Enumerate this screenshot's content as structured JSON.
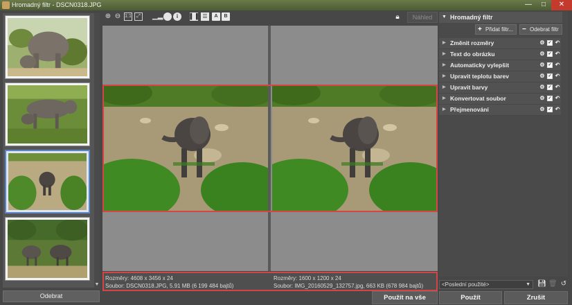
{
  "window": {
    "title": "Hromadný filtr - DSCN0318.JPG",
    "minimize_glyph": "—",
    "maximize_glyph": "□",
    "close_glyph": "✕"
  },
  "left_panel": {
    "remove_button": "Odebrat"
  },
  "toolbar": {
    "compare_preview_label": "Náhled"
  },
  "preview": {
    "left": {
      "dimensions": "Rozměry: 4608 x 3456 x 24",
      "file": "Soubor: DSCN0318.JPG, 5.91 MB (6 199 484 bajtů)"
    },
    "right": {
      "dimensions": "Rozměry: 1600 x 1200 x 24",
      "file": "Soubor: IMG_20160529_132757.jpg, 663 KB (678 984 bajtů)"
    }
  },
  "filter_panel": {
    "title": "Hromadný filtr",
    "add_filter": "Přidat filtr...",
    "remove_filter": "Odebrat filtr",
    "filters": [
      {
        "label": "Změnit rozměry"
      },
      {
        "label": "Text do obrázku"
      },
      {
        "label": "Automaticky vylepšit"
      },
      {
        "label": "Upravit teplotu barev"
      },
      {
        "label": "Upravit barvy"
      },
      {
        "label": "Konvertovat soubor"
      },
      {
        "label": "Přejmenování"
      }
    ],
    "preset_value": "<Poslední použité>"
  },
  "actions": {
    "apply_all": "Použít na vše",
    "apply": "Použít",
    "cancel": "Zrušit"
  },
  "icons": [
    "zoom-in-icon",
    "zoom-out-icon",
    "actual-size-icon",
    "fit-icon",
    "histogram-icon",
    "circle-icon",
    "info-icon",
    "split-vertical-icon",
    "split-horizontal-icon",
    "view-a-icon",
    "view-b-icon",
    "lock-icon",
    "gear-icon",
    "checkbox-icon",
    "undo-icon",
    "save-icon",
    "trash-icon"
  ],
  "colors": {
    "highlight": "#d64545",
    "selected_thumb": "#5a86c9",
    "titlebar": "#5a6a3c"
  }
}
